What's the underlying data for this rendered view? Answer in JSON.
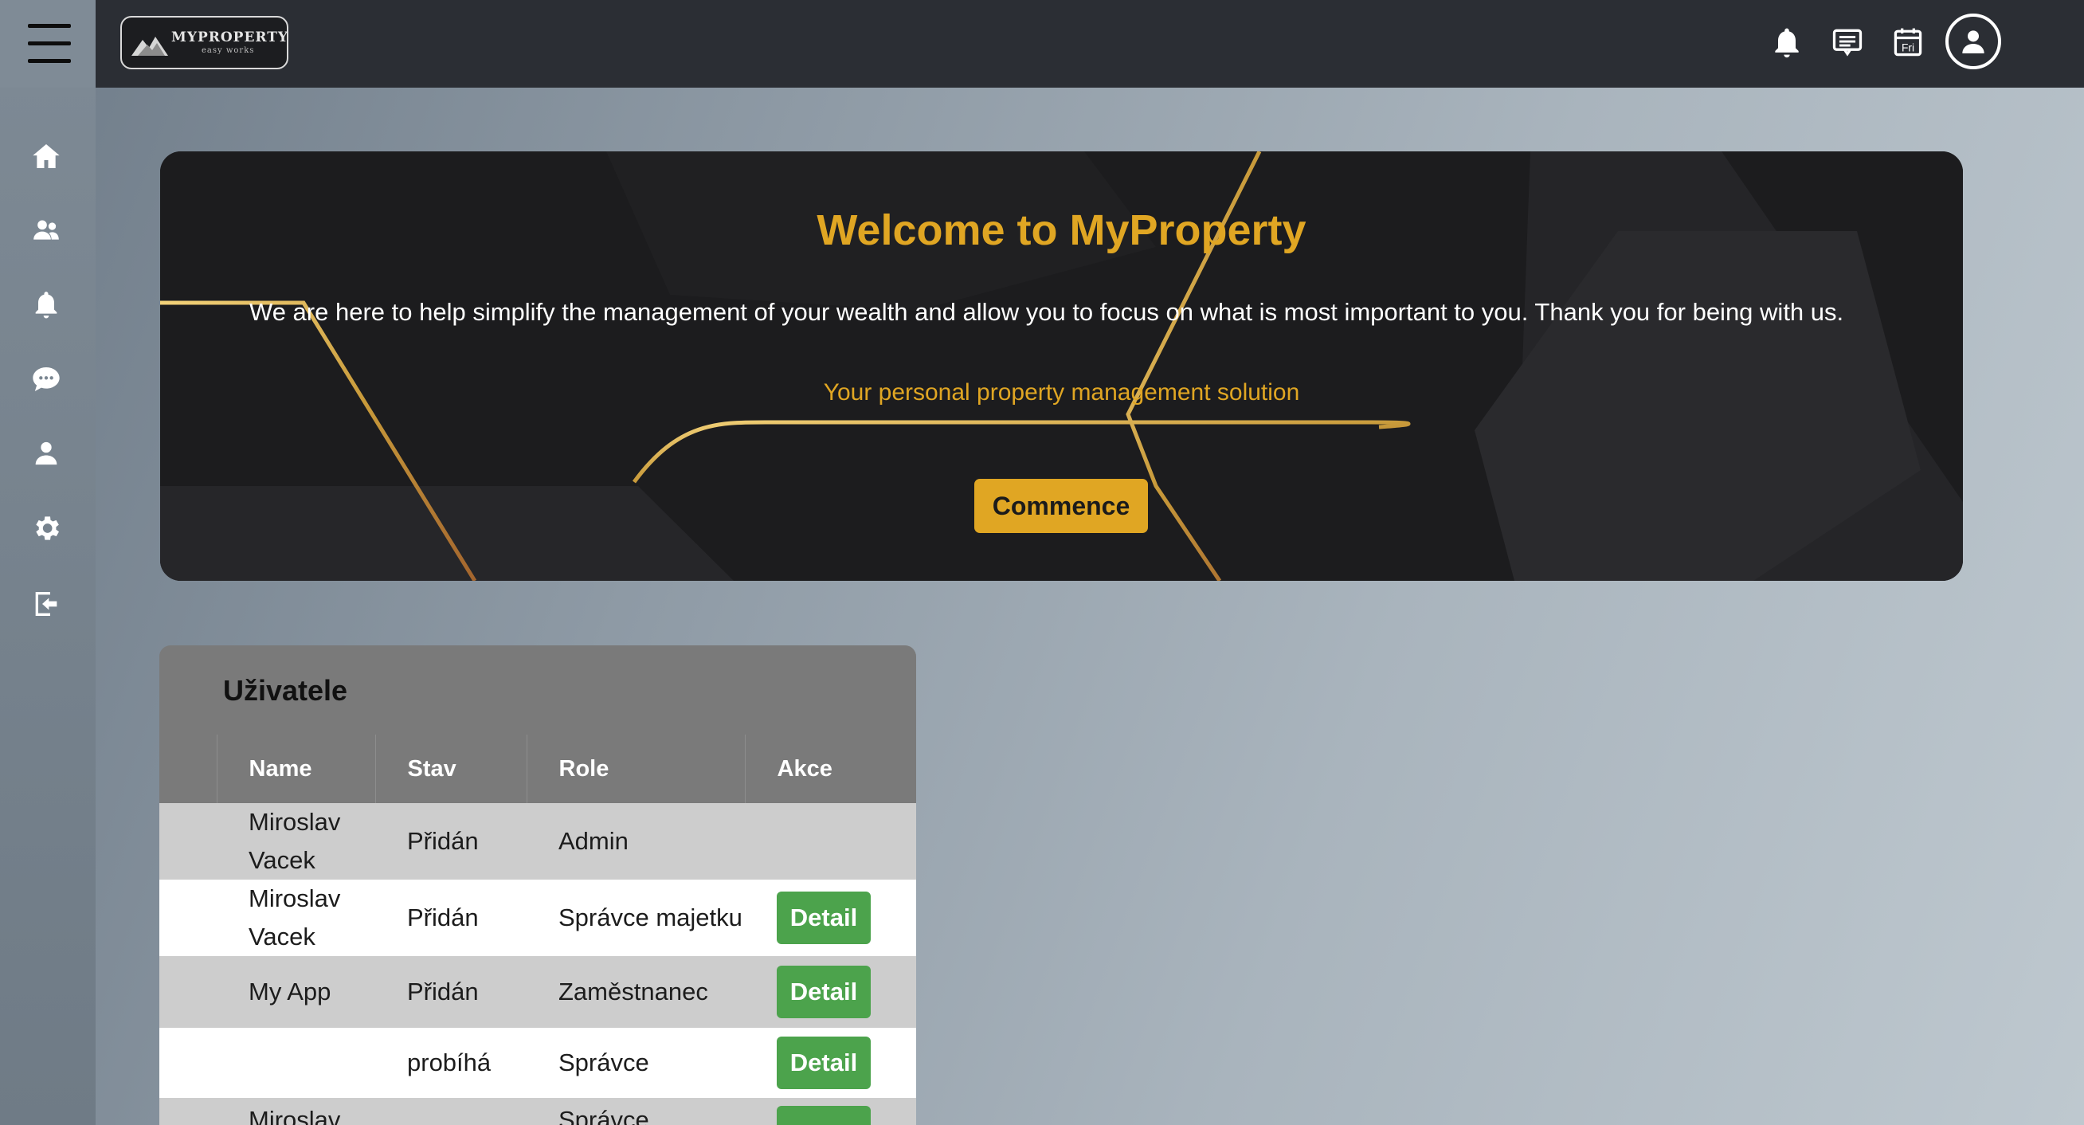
{
  "header": {
    "logo_title": "MYPROPERTY",
    "logo_subtitle": "easy works",
    "calendar_label": "Fri"
  },
  "sidebar": {
    "items": [
      {
        "icon": "home-icon"
      },
      {
        "icon": "users-icon"
      },
      {
        "icon": "bell-icon"
      },
      {
        "icon": "chat-icon"
      },
      {
        "icon": "profile-icon"
      },
      {
        "icon": "gear-icon"
      },
      {
        "icon": "logout-icon"
      }
    ]
  },
  "hero": {
    "title": "Welcome to MyProperty",
    "text": "We are here to help simplify the management of your wealth and allow you to focus on what is most important to you. Thank you for being with us.",
    "tagline": "Your personal property management solution",
    "button_label": "Commence"
  },
  "users": {
    "title": "Uživatele",
    "columns": [
      "Name",
      "Stav",
      "Role",
      "Akce"
    ],
    "rows": [
      {
        "name": "Miroslav Vacek",
        "status": "Přidán",
        "role": "Admin",
        "action": ""
      },
      {
        "name": "Miroslav Vacek",
        "status": "Přidán",
        "role": "Správce majetku",
        "action": "Detail"
      },
      {
        "name": "My App",
        "status": "Přidán",
        "role": "Zaměstnanec",
        "action": "Detail"
      },
      {
        "name": "",
        "status": "probíhá",
        "role": "Správce",
        "action": "Detail"
      },
      {
        "name": "Miroslav",
        "status": "",
        "role": "Správce",
        "action": ""
      }
    ]
  },
  "colors": {
    "accent": "#e0a623",
    "header_bg": "#2b2e34",
    "detail_button": "#4ca34c"
  }
}
